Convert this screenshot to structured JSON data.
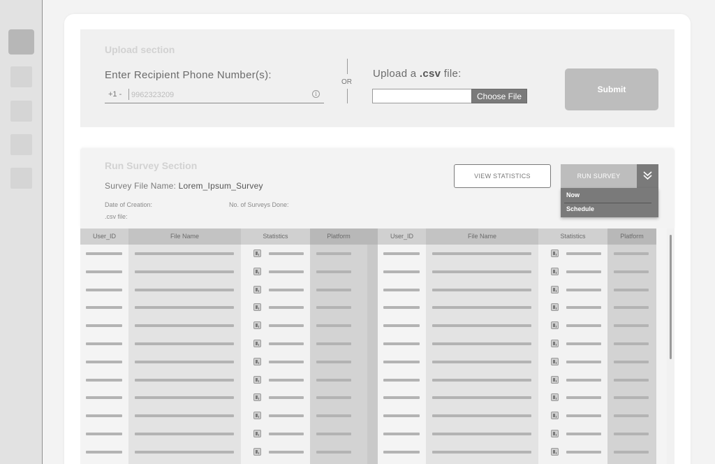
{
  "sidebar": {
    "items": [
      {
        "name": "nav-item-1",
        "active": true
      },
      {
        "name": "nav-item-2",
        "active": false
      },
      {
        "name": "nav-item-3",
        "active": false
      },
      {
        "name": "nav-item-4",
        "active": false
      },
      {
        "name": "nav-item-5",
        "active": false
      }
    ]
  },
  "upload": {
    "title": "Upload section",
    "phone_label": "Enter Recipient Phone Number(s):",
    "phone_prefix": "+1 -",
    "phone_placeholder": "9962323209",
    "info_icon": "i",
    "or_text": "OR",
    "csv_label_pre": "Upload a ",
    "csv_label_bold": ".csv",
    "csv_label_post": " file:",
    "choose_file": "Choose File",
    "submit": "Submit"
  },
  "run": {
    "title": "Run Survey Section",
    "survey_file_label": "Survey File Name:",
    "survey_file_name": "Lorem_Ipsum_Survey",
    "date_label": "Date of Creation:",
    "surveys_done_label": "No. of Surveys Done:",
    "csv_file_label": ".csv file:",
    "view_stats": "VIEW STATISTICS",
    "run_survey": "RUN SURVEY",
    "menu": [
      "Now",
      "Schedule"
    ]
  },
  "table": {
    "headers": [
      "User_ID",
      "File Name",
      "Statistics",
      "Platform"
    ],
    "row_count": 12
  },
  "colors": {
    "accent_dark": "#7a7a7a",
    "muted_button": "#bdbdbd"
  }
}
